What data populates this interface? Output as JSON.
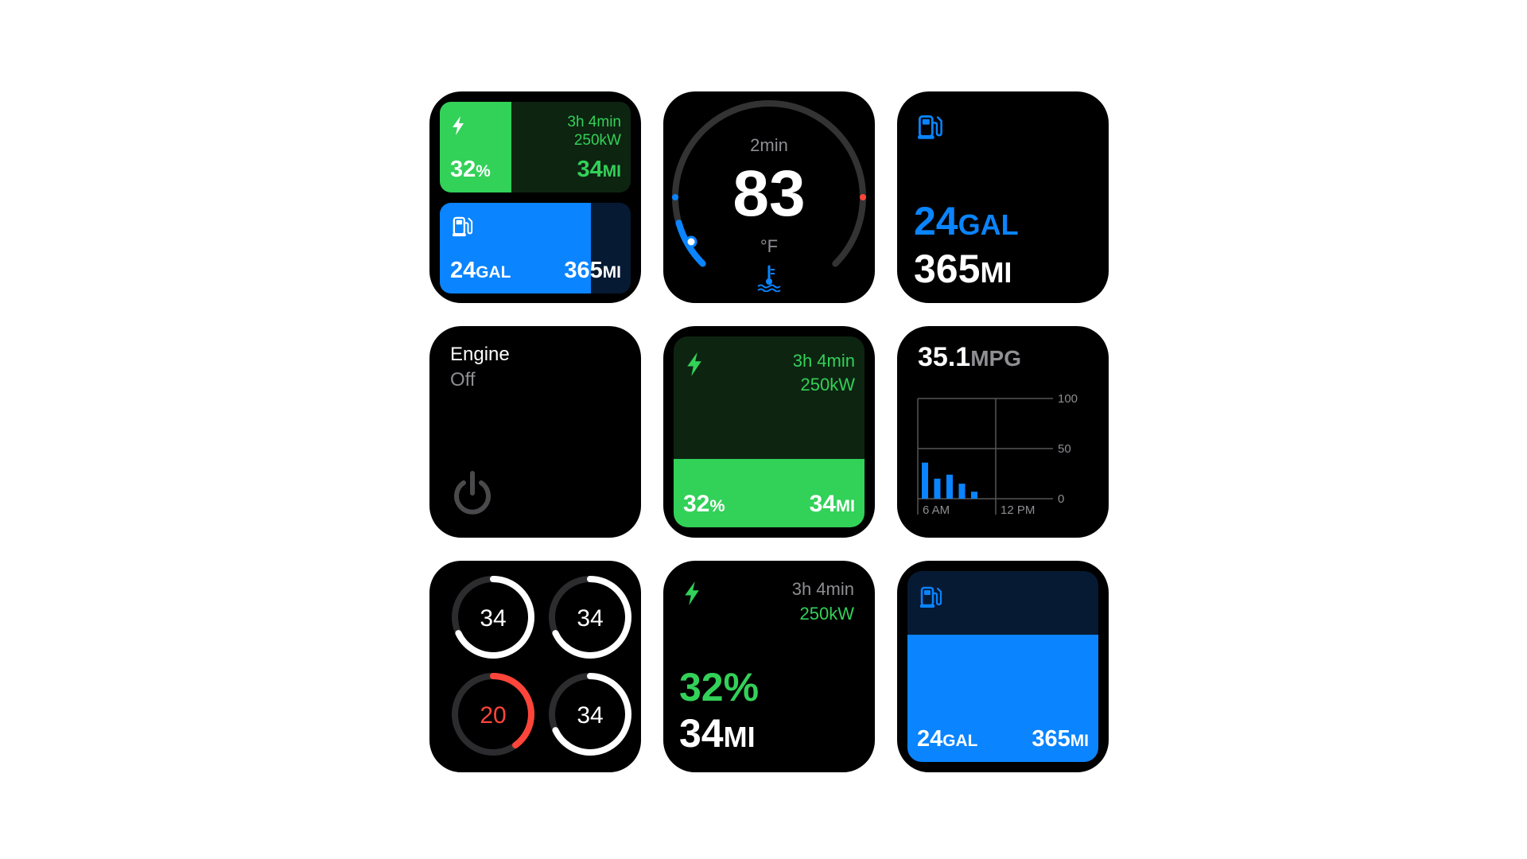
{
  "colors": {
    "green": "#32d158",
    "blue": "#0a84ff",
    "red": "#ff453a",
    "dark_green": "#0d2411",
    "dark_blue": "#061a33"
  },
  "tile1": {
    "ev": {
      "icon": "bolt-icon",
      "time": "3h 4min",
      "power": "250kW",
      "percent": "32",
      "percent_unit": "%",
      "range": "34",
      "range_unit": "MI",
      "level": 0.32
    },
    "fuel": {
      "icon": "fuel-pump-icon",
      "gallons": "24",
      "gallons_unit": "GAL",
      "range": "365",
      "range_unit": "MI",
      "level": 0.8
    }
  },
  "tile2": {
    "duration": "2min",
    "temp": "83",
    "unit": "°F",
    "icon": "coolant-temperature-icon",
    "level": 0.2
  },
  "tile3": {
    "icon": "fuel-pump-icon",
    "gallons": "24",
    "gallons_unit": "GAL",
    "range": "365",
    "range_unit": "MI"
  },
  "tile4": {
    "title": "Engine",
    "status": "Off",
    "icon": "power-icon"
  },
  "tile5": {
    "icon": "bolt-icon",
    "time": "3h 4min",
    "power": "250kW",
    "percent": "32",
    "percent_unit": "%",
    "range": "34",
    "range_unit": "MI",
    "level": 0.36
  },
  "tile6": {
    "value": "35.1",
    "unit": "MPG",
    "chart_data": {
      "type": "bar",
      "ylim": [
        0,
        100
      ],
      "yticks": [
        "100",
        "50",
        "0"
      ],
      "xticks": [
        "6 AM",
        "12 PM"
      ],
      "values": [
        36,
        20,
        24,
        15,
        7
      ]
    }
  },
  "tile7": {
    "gauges": [
      {
        "value": "34",
        "level": 0.68,
        "color": "#ffffff"
      },
      {
        "value": "34",
        "level": 0.68,
        "color": "#ffffff"
      },
      {
        "value": "20",
        "level": 0.4,
        "color": "#ff453a"
      },
      {
        "value": "34",
        "level": 0.68,
        "color": "#ffffff"
      }
    ]
  },
  "tile8": {
    "icon": "bolt-icon",
    "time": "3h 4min",
    "power": "250kW",
    "percent": "32%",
    "range": "34",
    "range_unit": "MI"
  },
  "tile9": {
    "icon": "fuel-pump-icon",
    "gallons": "24",
    "gallons_unit": "GAL",
    "range": "365",
    "range_unit": "MI",
    "level": 0.66
  }
}
